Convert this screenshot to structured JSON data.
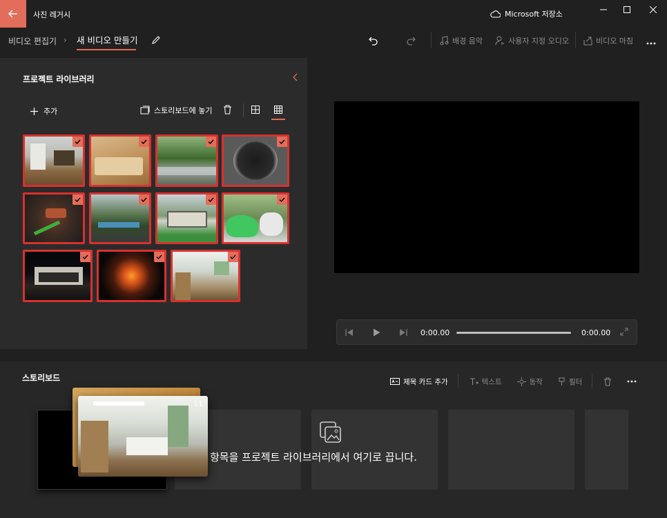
{
  "titlebar": {
    "app_title": "사진 레거시",
    "cloud_label": "Microsoft 저장소"
  },
  "commandbar": {
    "breadcrumb_root": "비디오 편집기",
    "breadcrumb_current": "새 비디오 만들기",
    "background_music": "배경 음악",
    "custom_audio": "사용자 지정 오디오",
    "finish_video": "비디오 마침"
  },
  "library": {
    "title": "프로젝트 라이브러리",
    "add_label": "추가",
    "place_label": "스토리보드에 놓기",
    "items": [
      {
        "name": "kitchen",
        "selected": true
      },
      {
        "name": "sofa",
        "selected": true
      },
      {
        "name": "stream",
        "selected": true
      },
      {
        "name": "charcoal",
        "selected": true
      },
      {
        "name": "grill",
        "selected": true
      },
      {
        "name": "campsite",
        "selected": true
      },
      {
        "name": "cabin",
        "selected": true
      },
      {
        "name": "dinosaur",
        "selected": true
      },
      {
        "name": "night-cabin",
        "selected": true
      },
      {
        "name": "campfire",
        "selected": true
      },
      {
        "name": "bunk-room",
        "selected": true
      }
    ]
  },
  "player": {
    "current_time": "0:00.00",
    "total_time": "0:00.00"
  },
  "storyboard": {
    "title": "스토리보드",
    "title_card": "제목 카드 추가",
    "text": "텍스트",
    "motion": "동작",
    "filter": "필터",
    "drop_hint": "항목을 프로젝트 라이브러리에서 여기로 끕니다.",
    "drag_count": "11"
  },
  "colors": {
    "accent": "#e26d5a",
    "selection_border": "#d9312f"
  }
}
